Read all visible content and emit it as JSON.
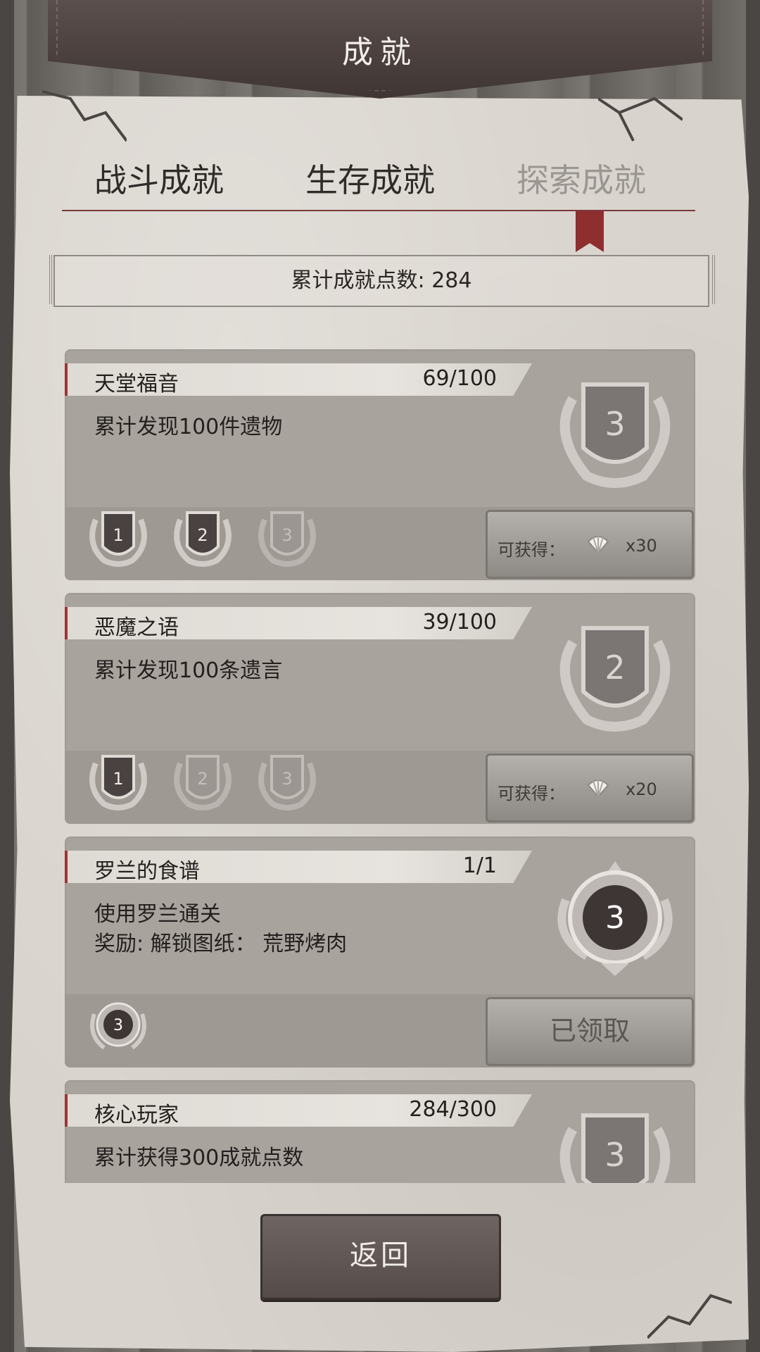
{
  "header": {
    "title": "成就"
  },
  "tabs": [
    {
      "label": "战斗成就",
      "active": false
    },
    {
      "label": "生存成就",
      "active": false
    },
    {
      "label": "探索成就",
      "active": true
    }
  ],
  "points": {
    "text": "累计成就点数: 284"
  },
  "achievements": [
    {
      "title": "天堂福音",
      "progress": "69/100",
      "desc": [
        "累计发现100件遗物"
      ],
      "big_badge": "3",
      "small_badges": [
        "1",
        "2",
        "3"
      ],
      "small_badge_unlocked": [
        true,
        true,
        false
      ],
      "button": {
        "type": "reward",
        "label": "可获得：",
        "icon": "shell-icon",
        "qty": "x30"
      }
    },
    {
      "title": "恶魔之语",
      "progress": "39/100",
      "desc": [
        "累计发现100条遗言"
      ],
      "big_badge": "2",
      "small_badges": [
        "1",
        "2",
        "3"
      ],
      "small_badge_unlocked": [
        true,
        false,
        false
      ],
      "button": {
        "type": "reward",
        "label": "可获得：",
        "icon": "shell-icon",
        "qty": "x20"
      }
    },
    {
      "title": "罗兰的食谱",
      "progress": "1/1",
      "desc": [
        "使用罗兰通关",
        "奖励: 解锁图纸： 荒野烤肉"
      ],
      "big_badge": "3",
      "small_badges": [
        "3"
      ],
      "small_badge_unlocked": [
        true
      ],
      "button": {
        "type": "claimed",
        "label": "已领取"
      }
    },
    {
      "title": "核心玩家",
      "progress": "284/300",
      "desc": [
        "累计获得300成就点数"
      ],
      "big_badge": "3",
      "small_badges": [],
      "small_badge_unlocked": [],
      "button": null
    }
  ],
  "footer": {
    "back_label": "返回"
  },
  "colors": {
    "accent": "#9a3636",
    "card": "#a8a39d",
    "paper": "#d8d3cc",
    "dark_button": "#5f5552"
  }
}
